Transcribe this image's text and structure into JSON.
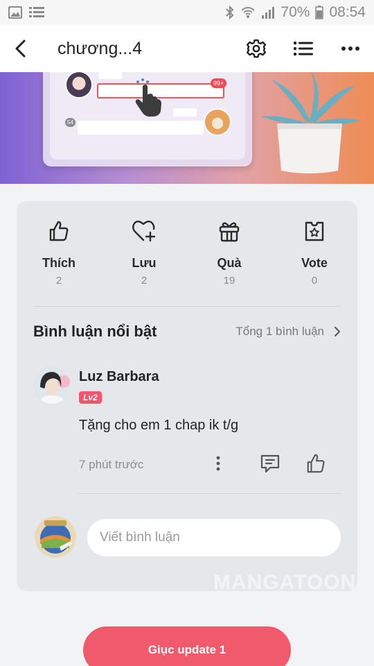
{
  "status_bar": {
    "battery_percent": "70%",
    "time": "08:54",
    "icons": [
      "image-icon",
      "list-icon",
      "bluetooth-icon",
      "wifi-icon",
      "signal-icon",
      "battery-icon"
    ]
  },
  "header": {
    "title": "chương...4",
    "icons": [
      "back-icon",
      "gear-icon",
      "list-icon",
      "more-icon"
    ]
  },
  "banner": {
    "badge_count": "99+",
    "badge_small": "54",
    "colors": {
      "gradient_start": "#7d62d4",
      "gradient_end": "#ee8c55"
    }
  },
  "actions": [
    {
      "label": "Thích",
      "count": "2",
      "icon": "thumb-up-icon"
    },
    {
      "label": "Lưu",
      "count": "2",
      "icon": "heart-plus-icon"
    },
    {
      "label": "Quà",
      "count": "19",
      "icon": "gift-icon"
    },
    {
      "label": "Vote",
      "count": "0",
      "icon": "vote-ticket-icon"
    }
  ],
  "comments_section": {
    "title": "Bình luận nổi bật",
    "total": "Tổng 1 bình luận",
    "comment": {
      "author": "Luz Barbara",
      "level": "Lv2",
      "text": "Tặng cho em 1 chap ik t/g",
      "time": "7 phút trước"
    },
    "input_placeholder": "Viết bình luận"
  },
  "watermark": "MANGATOON",
  "cta_label": "Giục update 1",
  "colors": {
    "accent": "#f05a6c",
    "badge": "#f1566f"
  }
}
